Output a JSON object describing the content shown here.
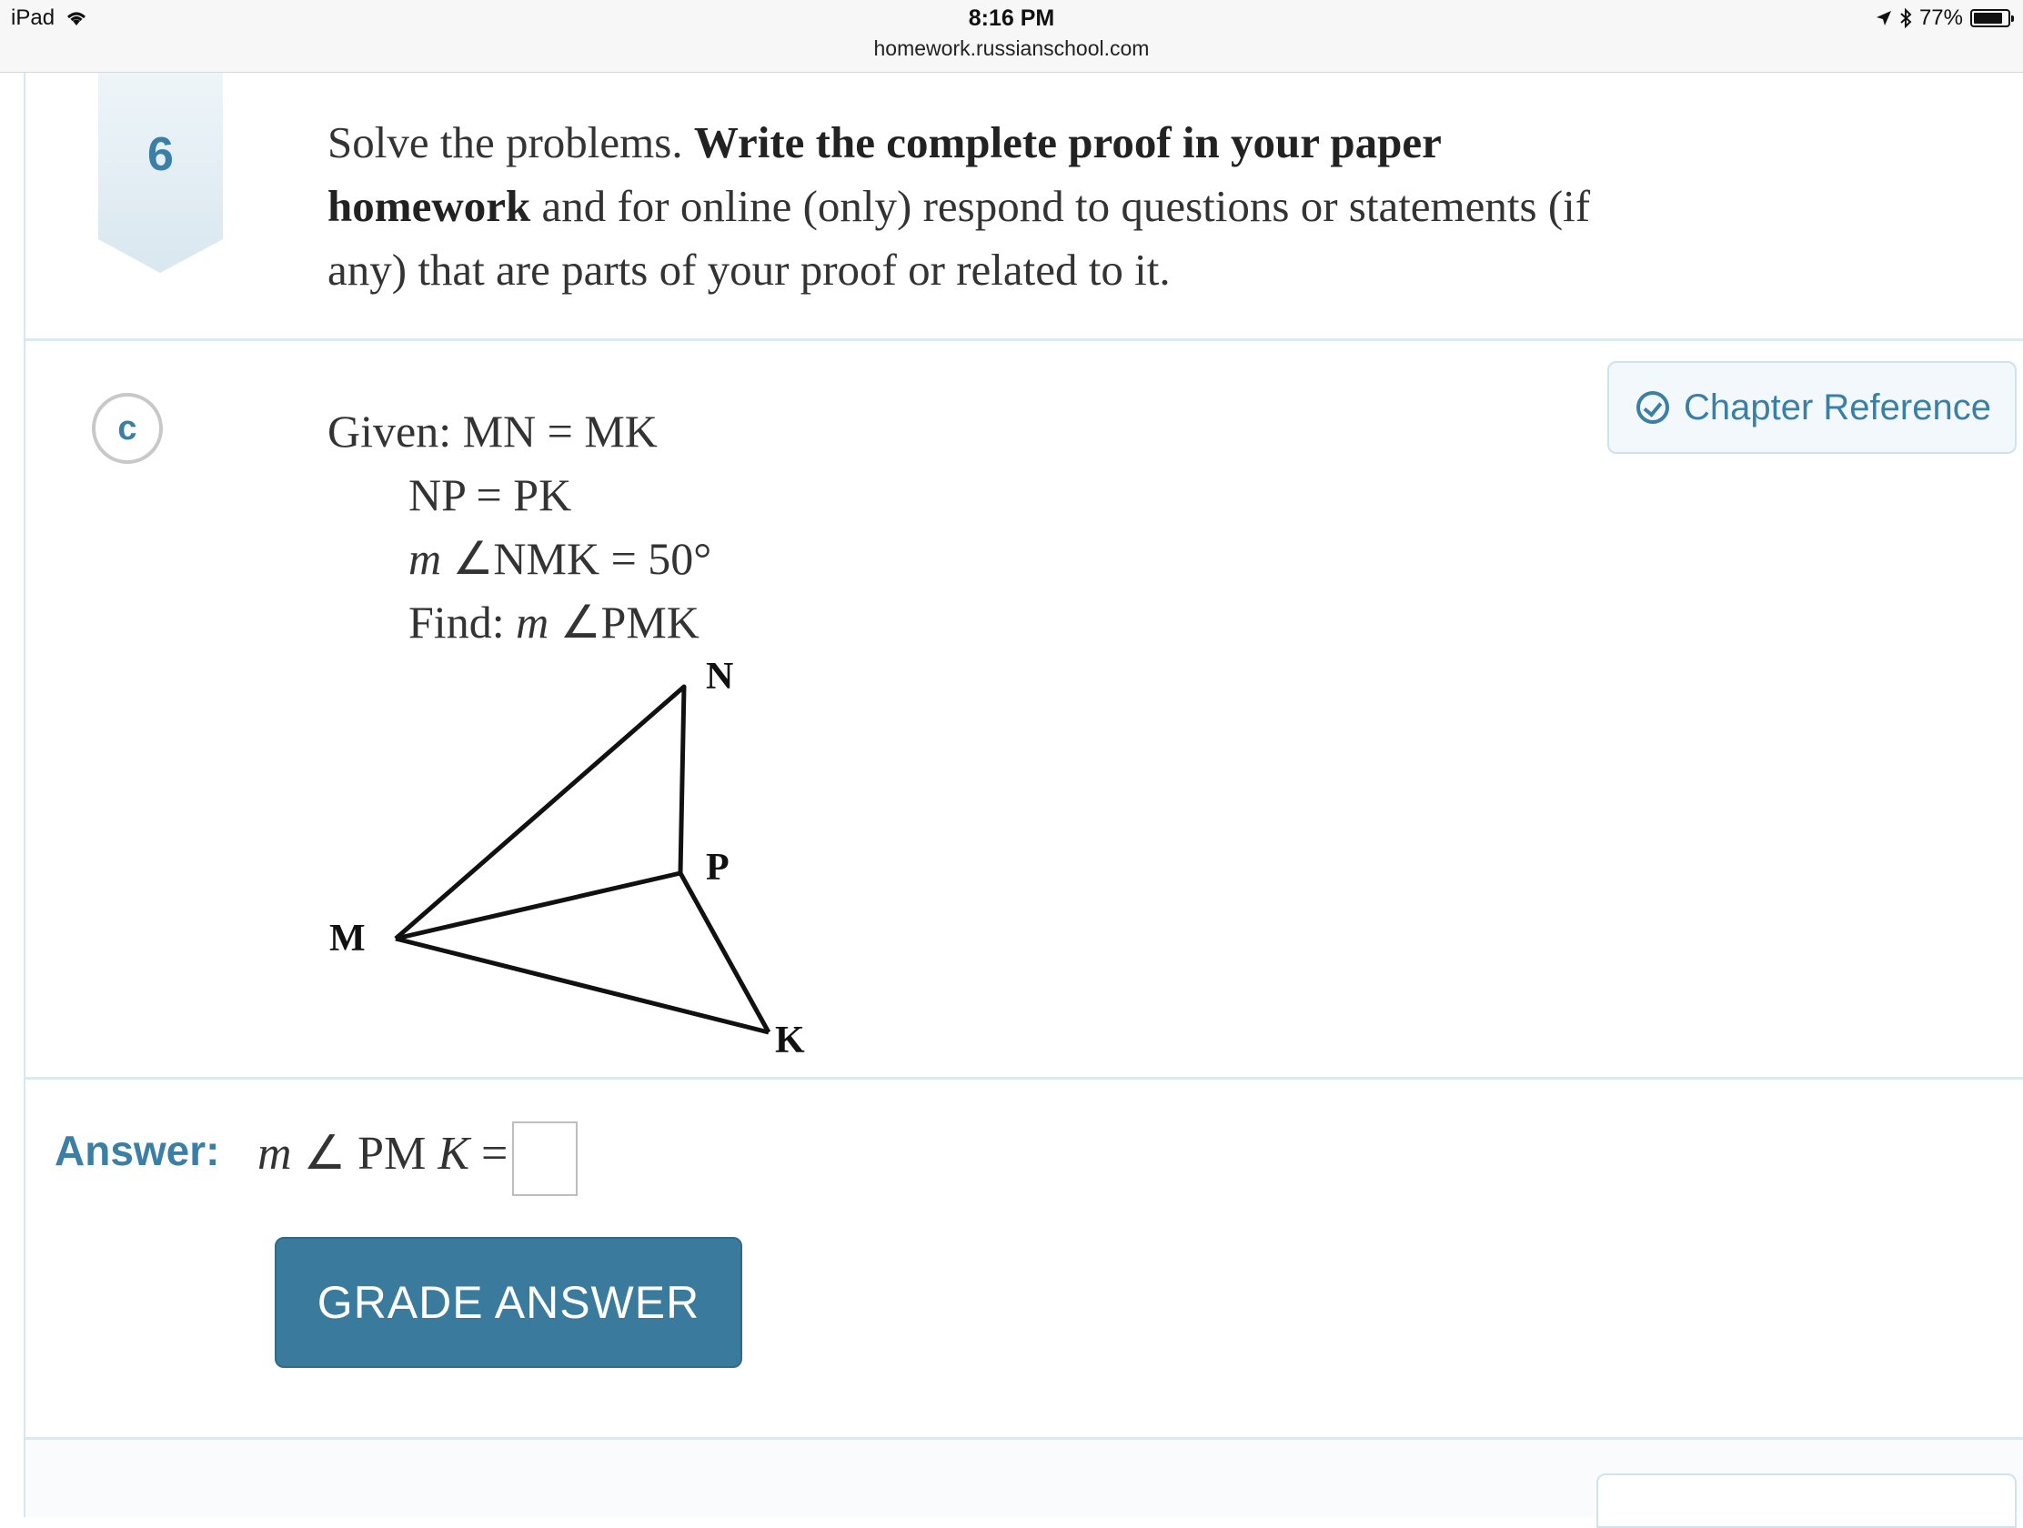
{
  "status_bar": {
    "device": "iPad",
    "time": "8:16 PM",
    "url": "homework.russianschool.com",
    "battery": "77%",
    "battery_level": 0.77
  },
  "problem": {
    "number": "6",
    "instructions_plain_1": "Solve the problems. ",
    "instructions_bold": "Write the complete proof in your paper homework",
    "instructions_plain_2": " and for online (only) respond to questions or statements (if any) that are parts of your proof or related to it."
  },
  "part": {
    "label": "c",
    "chapter_reference": "Chapter Reference",
    "given_line_1": "Given: MN = MK",
    "given_line_2": "NP = PK",
    "given_line_3_m": "m",
    "given_line_3_rest": " ∠NMK = 50°",
    "find_label": "Find: ",
    "find_m": "m",
    "find_rest": " ∠PMK",
    "figure_labels": {
      "n": "N",
      "p": "P",
      "m": "M",
      "k": "K"
    }
  },
  "answer": {
    "label": "Answer:",
    "expr_m": "m",
    "expr_mid": " ∠ PM ",
    "expr_k": "K",
    "expr_eq": " =",
    "value": ""
  },
  "buttons": {
    "grade": "GRADE ANSWER"
  },
  "colors": {
    "accent": "#3b7fa6",
    "button": "#3a7a9c",
    "rule": "#dceaf0"
  }
}
